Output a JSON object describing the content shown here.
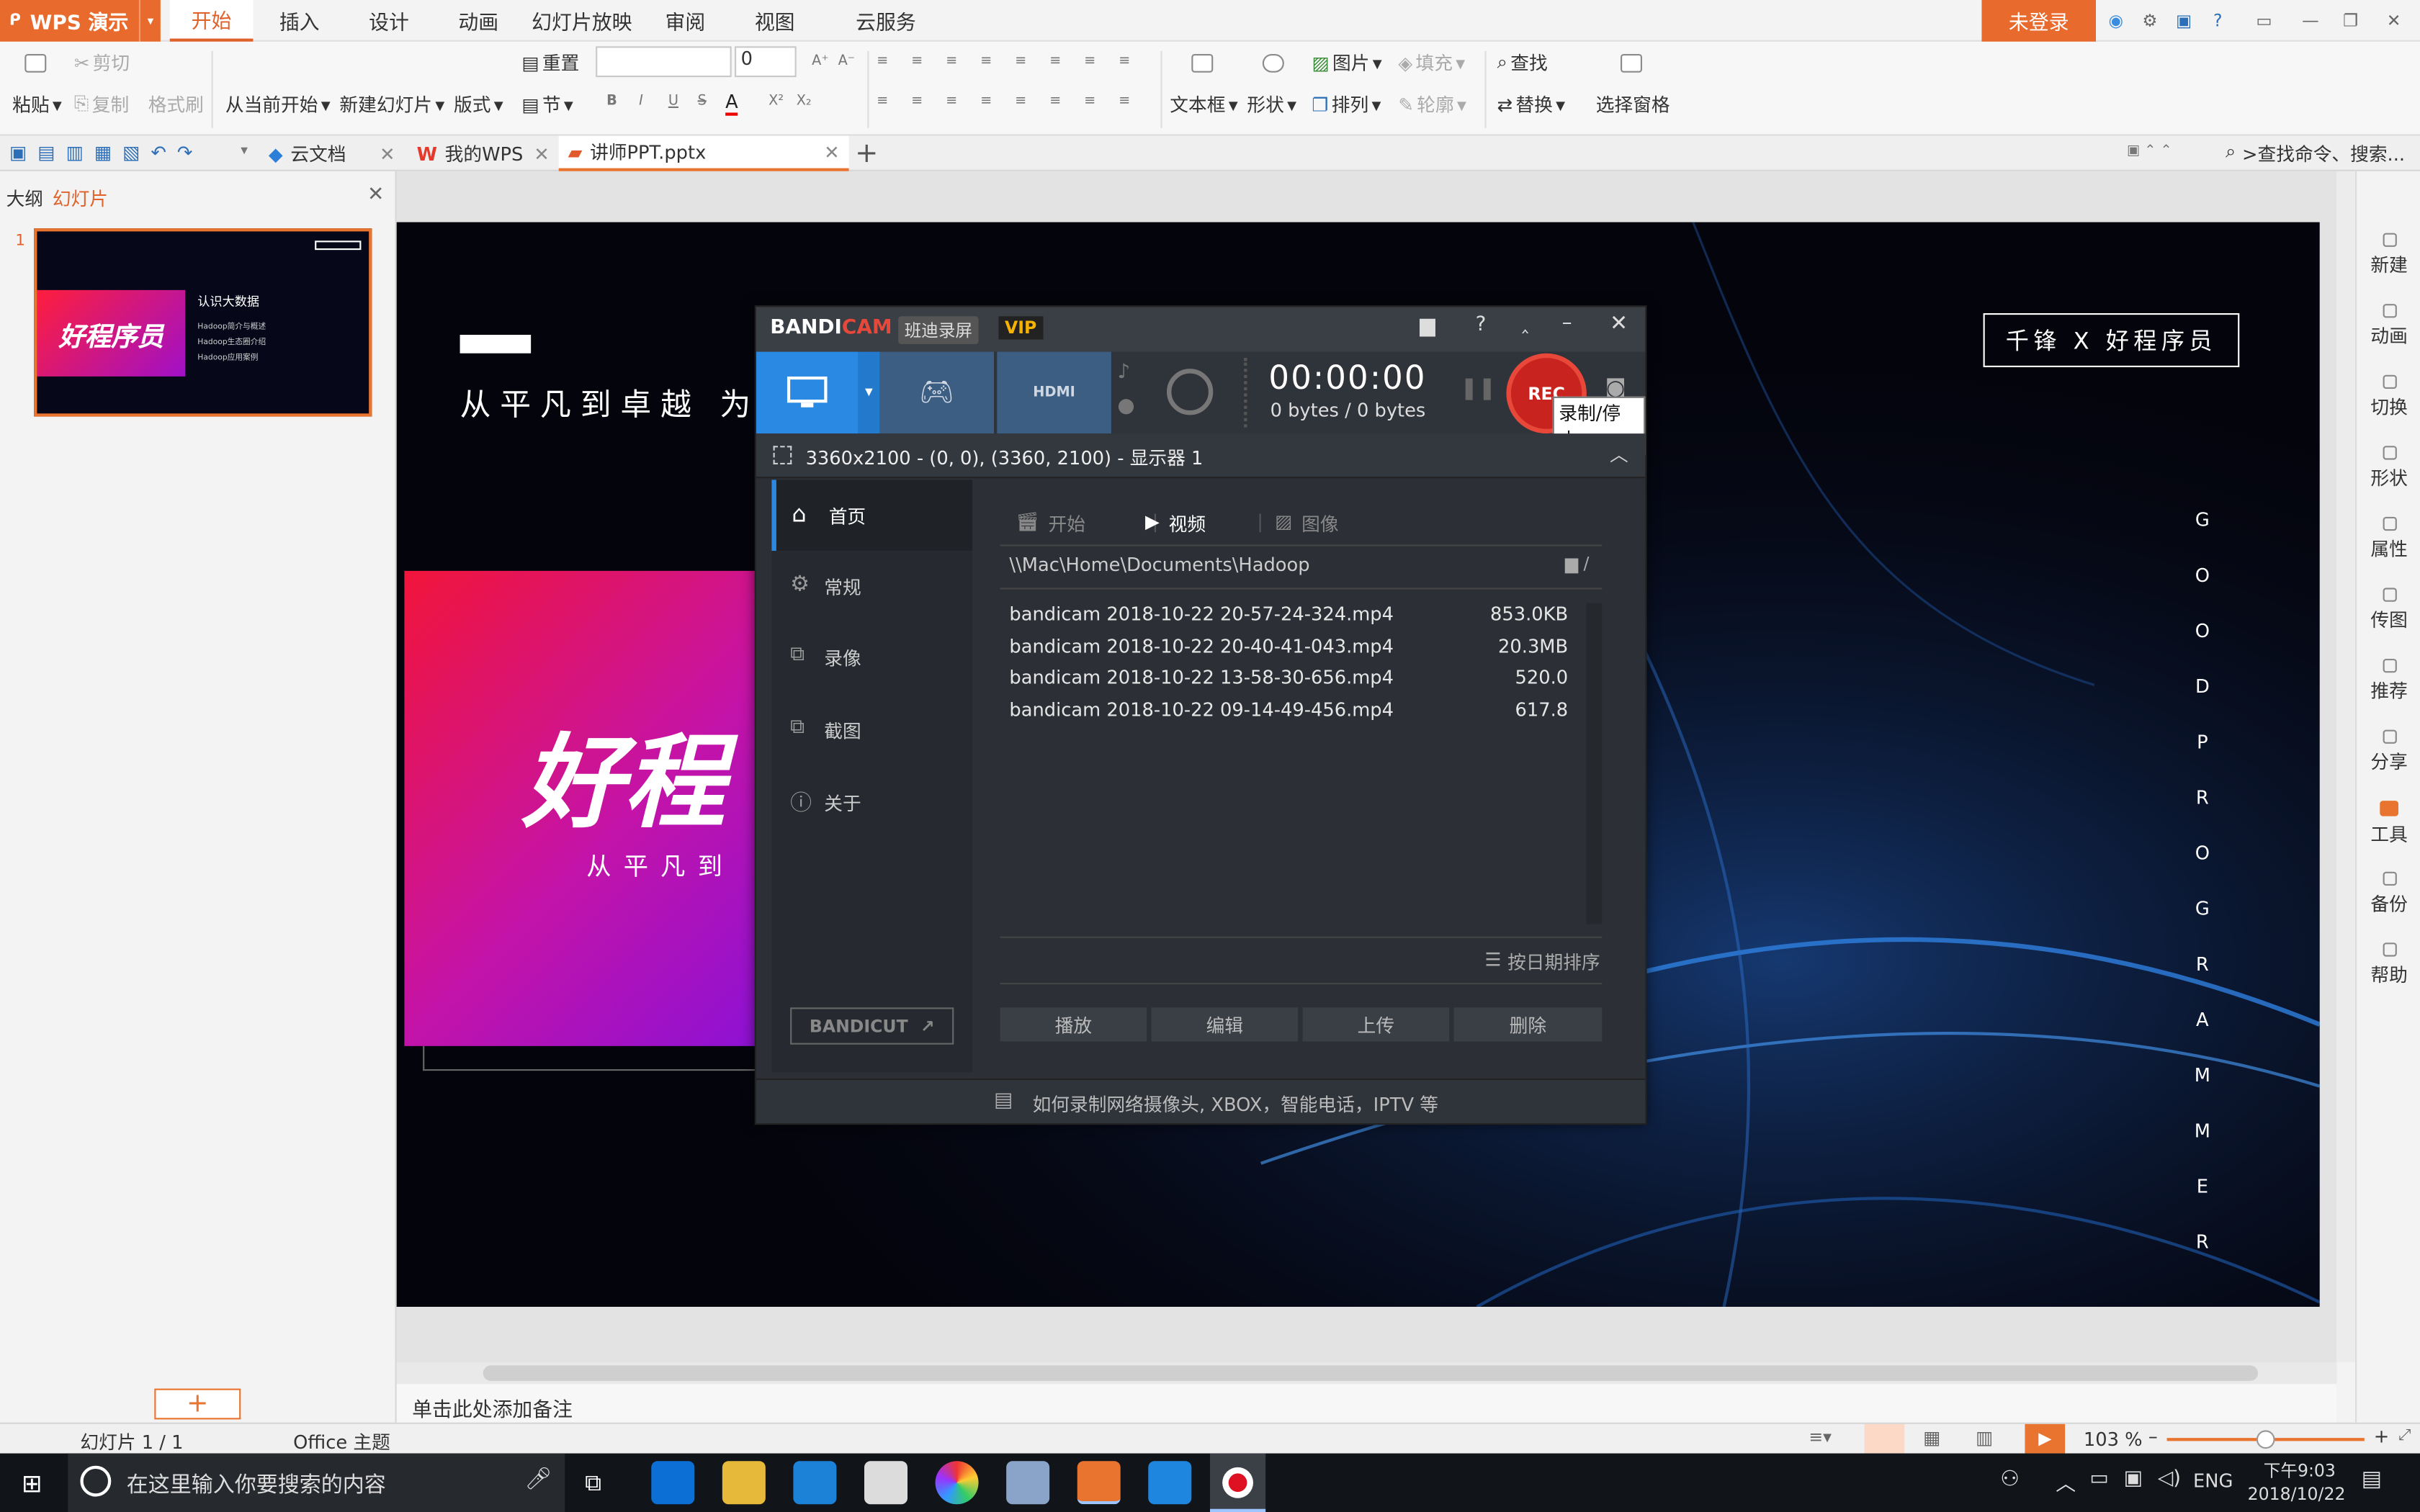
{
  "app": {
    "name": "WPS 演示",
    "login": "未登录"
  },
  "menu_tabs": [
    "开始",
    "插入",
    "设计",
    "动画",
    "幻灯片放映",
    "审阅",
    "视图",
    "云服务"
  ],
  "ribbon": {
    "paste": "粘贴",
    "cut": "剪切",
    "copy": "复制",
    "format_painter": "格式刷",
    "from_current": "从当前开始",
    "new_slide": "新建幻灯片",
    "layout": "版式",
    "reset": "重置",
    "section": "节",
    "font_size": "0",
    "bold": "B",
    "italic": "I",
    "underline": "U",
    "strike": "S",
    "textbox": "文本框",
    "shape": "形状",
    "picture": "图片",
    "fill": "填充",
    "arrange": "排列",
    "outline": "轮廓",
    "find": "查找",
    "replace": "替换",
    "select_pane": "选择窗格"
  },
  "doc_tabs": [
    {
      "label": "云文档"
    },
    {
      "label": "我的WPS"
    },
    {
      "label": "讲师PPT.pptx"
    }
  ],
  "search_cmd": ">查找命令、搜索...",
  "left_panel": {
    "tab_outline": "大纲",
    "tab_slides": "幻灯片",
    "slide_num": "1",
    "thumb_title": "认识大数据",
    "thumb_lines": [
      "Hadoop简介与概述",
      "Hadoop生态圈介绍",
      "Hadoop应用案例"
    ],
    "thumb_logo": "好程序员"
  },
  "slide": {
    "motto": "从平凡到卓越 为梦",
    "brand": "千锋 X 好程序员",
    "logo_text": "好程",
    "logo_sub": "从平凡到",
    "vertical_letters": [
      "G",
      "O",
      "O",
      "D",
      "P",
      "R",
      "O",
      "G",
      "R",
      "A",
      "M",
      "M",
      "E",
      "R"
    ]
  },
  "right_sidebar": [
    "新建",
    "动画",
    "切换",
    "形状",
    "属性",
    "传图",
    "推荐",
    "分享",
    "工具",
    "备份",
    "帮助"
  ],
  "notes_placeholder": "单击此处添加备注",
  "status": {
    "slide_count": "幻灯片 1 / 1",
    "theme": "Office 主题",
    "zoom": "103 %"
  },
  "bandicam": {
    "brand_a": "BANDI",
    "brand_b": "CAM",
    "brand_cn": "班迪录屏",
    "vip": "VIP",
    "timer": "00:00:00",
    "bytes": "0 bytes / 0 bytes",
    "rec": "REC",
    "rec_tip": "录制/停止",
    "region": "3360x2100 - (0, 0), (3360, 2100) - 显示器 1",
    "nav": [
      "首页",
      "常规",
      "录像",
      "截图",
      "关于"
    ],
    "tabs": [
      "开始",
      "视频",
      "图像"
    ],
    "path": "\\\\Mac\\Home\\Documents\\Hadoop",
    "files": [
      {
        "name": "bandicam 2018-10-22 20-57-24-324.mp4",
        "size": "853.0KB"
      },
      {
        "name": "bandicam 2018-10-22 20-40-41-043.mp4",
        "size": "20.3MB"
      },
      {
        "name": "bandicam 2018-10-22 13-58-30-656.mp4",
        "size": "520.0"
      },
      {
        "name": "bandicam 2018-10-22 09-14-49-456.mp4",
        "size": "617.8"
      }
    ],
    "sort": "按日期排序",
    "actions": [
      "播放",
      "编辑",
      "上传",
      "删除"
    ],
    "bandicut": "BANDICUT",
    "footer": "如何录制网络摄像头, XBOX，智能电话，IPTV 等"
  },
  "taskbar": {
    "search": "在这里输入你要搜索的内容",
    "lang": "ENG",
    "time": "下午9:03",
    "date": "2018/10/22"
  }
}
